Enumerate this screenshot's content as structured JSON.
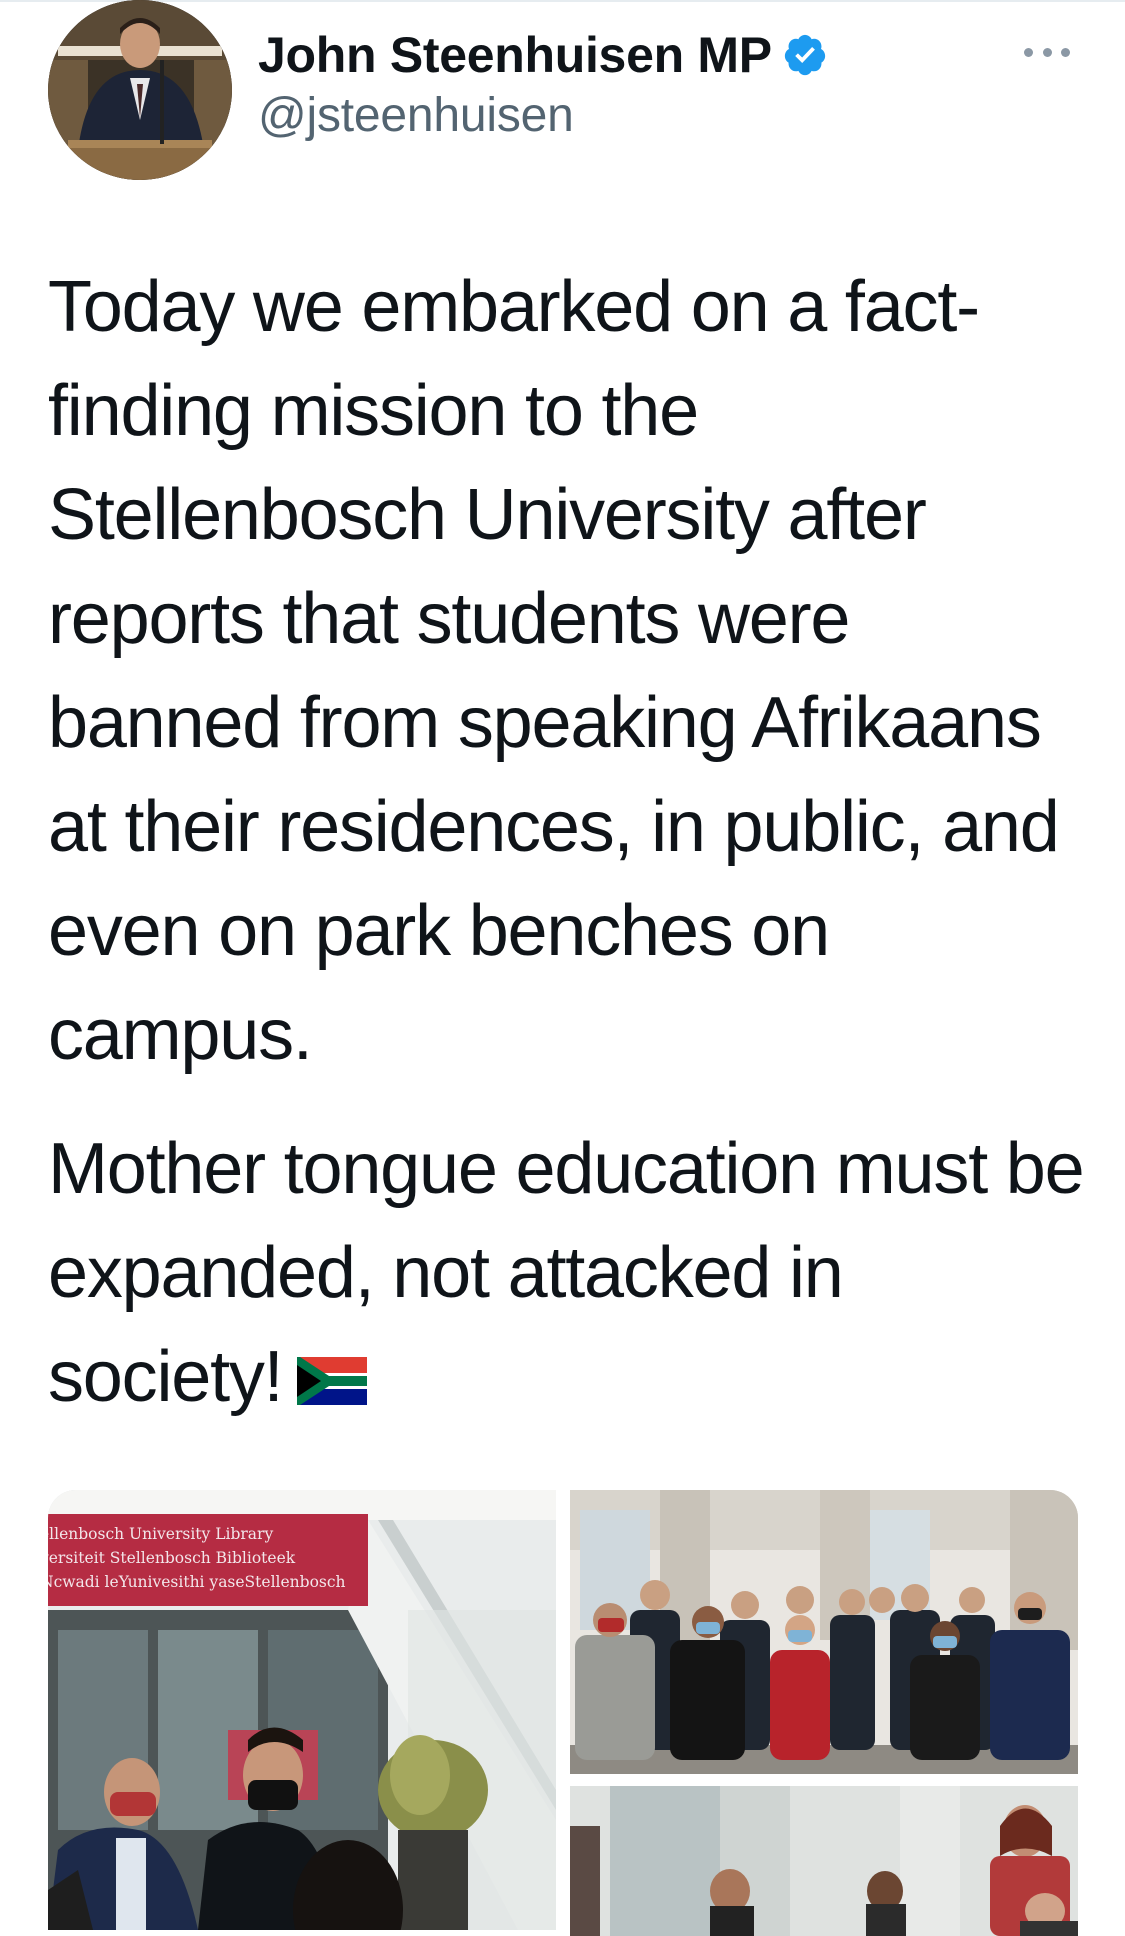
{
  "tweet": {
    "author": {
      "display_name": "John Steenhuisen MP",
      "handle": "@jsteenhuisen",
      "verified": true
    },
    "paragraphs": [
      "Today we embarked on a fact-finding mission to the Stellenbosch University after reports that students were banned from speaking Afrikaans at their residences, in public, and even on park benches on campus.",
      "Mother tongue education must be expanded, not attacked in society!"
    ],
    "emoji": "south-africa-flag",
    "media": {
      "count": 3,
      "library_sign": [
        "ellenbosch University Library",
        "versiteit Stellenbosch Biblioteek",
        "Ncwadi leYunivesithi yaseStellenbosch"
      ]
    }
  },
  "colors": {
    "text_primary": "#0f1419",
    "text_secondary": "#536471",
    "verified_blue": "#1d9bf0",
    "sign_red": "#b52c43"
  },
  "icons": {
    "verified": "verified-badge-icon",
    "more": "more-options-icon"
  }
}
